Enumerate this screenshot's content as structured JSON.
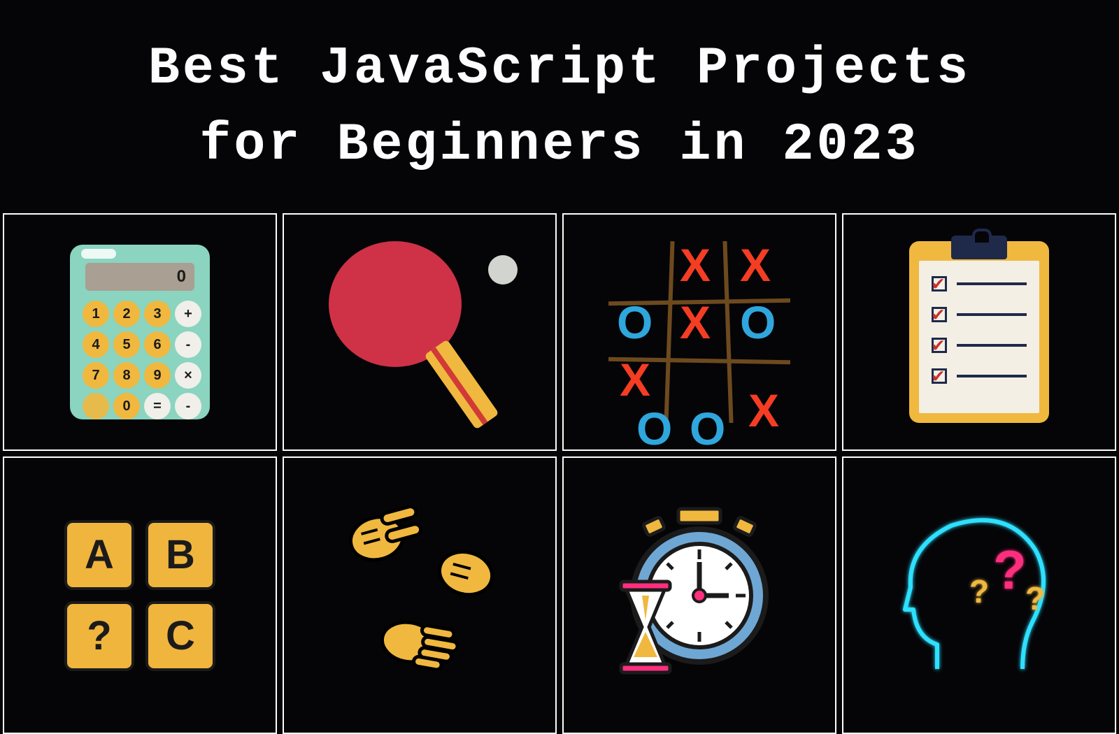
{
  "title": {
    "line1": "Best JavaScript Projects",
    "line2": "for Beginners in 2023"
  },
  "projects": [
    {
      "id": "calculator",
      "icon": "calculator-icon",
      "label": "Calculator"
    },
    {
      "id": "pong",
      "icon": "ping-pong-icon",
      "label": "Ping Pong"
    },
    {
      "id": "tictactoe",
      "icon": "tic-tac-toe-icon",
      "label": "Tic Tac Toe"
    },
    {
      "id": "todo",
      "icon": "checklist-icon",
      "label": "To-Do List"
    },
    {
      "id": "hangman",
      "icon": "letter-tiles-icon",
      "label": "Hangman / Word Game"
    },
    {
      "id": "rps",
      "icon": "rock-paper-scissors-icon",
      "label": "Rock Paper Scissors"
    },
    {
      "id": "timer",
      "icon": "clock-hourglass-icon",
      "label": "Timer / Stopwatch"
    },
    {
      "id": "quiz",
      "icon": "quiz-head-icon",
      "label": "Quiz App"
    }
  ],
  "calculator": {
    "screen": "0",
    "keys": [
      [
        "1",
        "2",
        "3",
        "+"
      ],
      [
        "4",
        "5",
        "6",
        "-"
      ],
      [
        "7",
        "8",
        "9",
        "×"
      ],
      [
        "",
        "0",
        "=",
        "-"
      ]
    ]
  },
  "tictactoe": {
    "cells": [
      "",
      "X",
      "X",
      "O",
      "X",
      "O",
      "X",
      "",
      "",
      "O",
      "O",
      "",
      "X"
    ]
  },
  "hangman": {
    "tiles": [
      "A",
      "B",
      "?",
      "C"
    ]
  },
  "checklist": {
    "rows": 4,
    "checked": [
      true,
      true,
      true,
      true
    ]
  },
  "colors": {
    "bg": "#050508",
    "fg": "#fdfdfd",
    "teal": "#8ad4c0",
    "amber": "#f0b83f",
    "red": "#cf3146",
    "orange": "#f53d23",
    "blue": "#2fa6dc",
    "navy": "#1f2a4a",
    "paper": "#f3efe5",
    "neonPink": "#ff2e7e",
    "neonCyan": "#2de0ff"
  }
}
